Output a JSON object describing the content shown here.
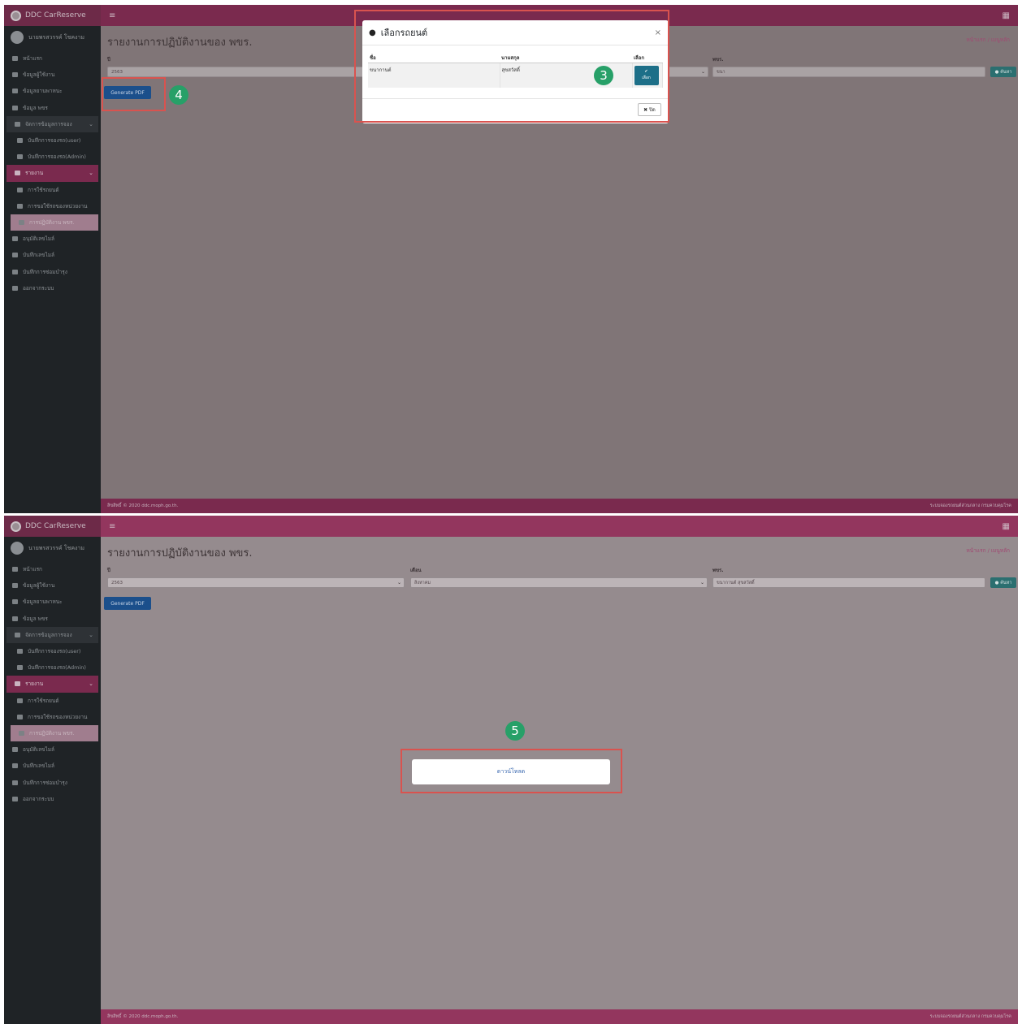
{
  "app": {
    "brand": "DDC CarReserve",
    "menu_icon": "≡",
    "apps_icon": "▦"
  },
  "user": {
    "name": "นายพรสวรรค์ โชคงาม"
  },
  "sidebar": {
    "items": [
      {
        "label": "หน้าแรก",
        "icon": "home-icon"
      },
      {
        "label": "ข้อมูลผู้ใช้งาน",
        "icon": "user-icon"
      },
      {
        "label": "ข้อมูลยานพาหนะ",
        "icon": "car-icon"
      },
      {
        "label": "ข้อมูล พขร",
        "icon": "id-card-icon"
      },
      {
        "label": "จัดการข้อมูลการจอง",
        "icon": "calendar-icon"
      },
      {
        "label": "บันทึกการจองรถ(user)",
        "icon": "calendar-plus-icon"
      },
      {
        "label": "บันทึกการจองรถ(Admin)",
        "icon": "calendar-plus-icon"
      },
      {
        "label": "รายงาน",
        "icon": "chart-icon"
      },
      {
        "label": "การใช้รถยนต์",
        "icon": "report-icon"
      },
      {
        "label": "การขอใช้รถของหน่วยงาน",
        "icon": "report-icon"
      },
      {
        "label": "การปฏิบัติงาน พขร.",
        "icon": "user-icon"
      },
      {
        "label": "อนุมัติเลขไมล์",
        "icon": "gauge-icon"
      },
      {
        "label": "บันทึกเลขไมล์",
        "icon": "gauge-icon"
      },
      {
        "label": "บันทึกการซ่อมบำรุง",
        "icon": "wrench-icon"
      },
      {
        "label": "ออกจากระบบ",
        "icon": "logout-icon"
      }
    ]
  },
  "page": {
    "title": "รายงานการปฏิบัติงานของ พขร.",
    "breadcrumb": "หน้าแรก / เมนูหลัก",
    "year_label": "ปี",
    "month_label": "เดือน",
    "driver_label": "พขร.",
    "generate_label": "Generate PDF",
    "search_label": "ค้นหา"
  },
  "panel1": {
    "year_value": "2563",
    "driver_value": "ขนา",
    "badge_modal": "3",
    "badge_generate": "4"
  },
  "modal": {
    "title": "เลือกรถยนต์",
    "close_x": "×",
    "headers": [
      "ชื่อ",
      "นามสกุล",
      "เลือก"
    ],
    "row": {
      "first": "ขนากานต์",
      "last": "สุขสวัสดิ์",
      "pick": "เลือก"
    },
    "close_label": "ปิด"
  },
  "panel2": {
    "year_value": "2563",
    "month_value": "สิงหาคม",
    "driver_value": "ขนากานต์ สุขสวัสดิ์",
    "download_label": "ดาวน์โหลด",
    "badge_download": "5"
  },
  "footer": {
    "left": "ลิขสิทธิ์ © 2020 ddc.moph.go.th.",
    "right": "ระบบจองรถยนต์ส่วนกลาง กรมควบคุมโรค"
  },
  "colors": {
    "brand": "#7a2a4e",
    "highlight": "#d9534f",
    "badge": "#27a068",
    "primary": "#1b4f8b"
  }
}
